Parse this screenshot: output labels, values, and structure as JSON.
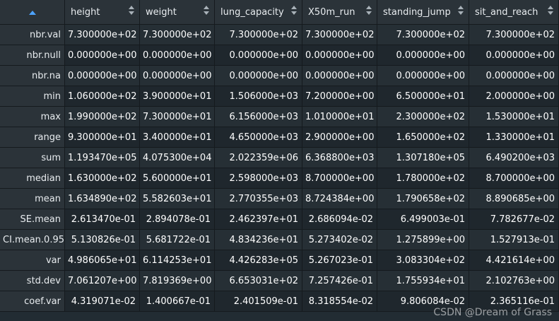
{
  "table": {
    "columns": [
      "height",
      "weight",
      "lung_capacity",
      "X50m_run",
      "standing_jump",
      "sit_and_reach"
    ],
    "rows": [
      {
        "name": "nbr.val",
        "values": [
          "7.300000e+02",
          "7.300000e+02",
          "7.300000e+02",
          "7.300000e+02",
          "7.300000e+02",
          "7.300000e+02"
        ]
      },
      {
        "name": "nbr.null",
        "values": [
          "0.000000e+00",
          "0.000000e+00",
          "0.000000e+00",
          "0.000000e+00",
          "0.000000e+00",
          "0.000000e+00"
        ]
      },
      {
        "name": "nbr.na",
        "values": [
          "0.000000e+00",
          "0.000000e+00",
          "0.000000e+00",
          "0.000000e+00",
          "0.000000e+00",
          "0.000000e+00"
        ]
      },
      {
        "name": "min",
        "values": [
          "1.060000e+02",
          "3.900000e+01",
          "1.506000e+03",
          "7.200000e+00",
          "6.500000e+01",
          "2.000000e+00"
        ]
      },
      {
        "name": "max",
        "values": [
          "1.990000e+02",
          "7.300000e+01",
          "6.156000e+03",
          "1.010000e+01",
          "2.300000e+02",
          "1.530000e+01"
        ]
      },
      {
        "name": "range",
        "values": [
          "9.300000e+01",
          "3.400000e+01",
          "4.650000e+03",
          "2.900000e+00",
          "1.650000e+02",
          "1.330000e+01"
        ]
      },
      {
        "name": "sum",
        "values": [
          "1.193470e+05",
          "4.075300e+04",
          "2.022359e+06",
          "6.368800e+03",
          "1.307180e+05",
          "6.490200e+03"
        ]
      },
      {
        "name": "median",
        "values": [
          "1.630000e+02",
          "5.600000e+01",
          "2.598000e+03",
          "8.700000e+00",
          "1.780000e+02",
          "8.700000e+00"
        ]
      },
      {
        "name": "mean",
        "values": [
          "1.634890e+02",
          "5.582603e+01",
          "2.770355e+03",
          "8.724384e+00",
          "1.790658e+02",
          "8.890685e+00"
        ]
      },
      {
        "name": "SE.mean",
        "values": [
          "2.613470e-01",
          "2.894078e-01",
          "2.462397e+01",
          "2.686094e-02",
          "6.499003e-01",
          "7.782677e-02"
        ]
      },
      {
        "name": "CI.mean.0.95",
        "values": [
          "5.130826e-01",
          "5.681722e-01",
          "4.834236e+01",
          "5.273402e-02",
          "1.275899e+00",
          "1.527913e-01"
        ]
      },
      {
        "name": "var",
        "values": [
          "4.986065e+01",
          "6.114253e+01",
          "4.426283e+05",
          "5.267023e-01",
          "3.083304e+02",
          "4.421614e+00"
        ]
      },
      {
        "name": "std.dev",
        "values": [
          "7.061207e+00",
          "7.819369e+00",
          "6.653031e+02",
          "7.257426e-01",
          "1.755934e+01",
          "2.102763e+00"
        ]
      },
      {
        "name": "coef.var",
        "values": [
          "4.319071e-02",
          "1.400667e-01",
          "2.401509e-01",
          "8.318554e-02",
          "9.806084e-02",
          "2.365116e-01"
        ]
      }
    ]
  },
  "watermark": "CSDN @Dream of Grass",
  "icons": {
    "corner": "sort-ascending-icon",
    "header": "sort-icon"
  },
  "colors": {
    "background": "#222c33",
    "header": "#2b3339",
    "accent": "#4da3ff"
  }
}
